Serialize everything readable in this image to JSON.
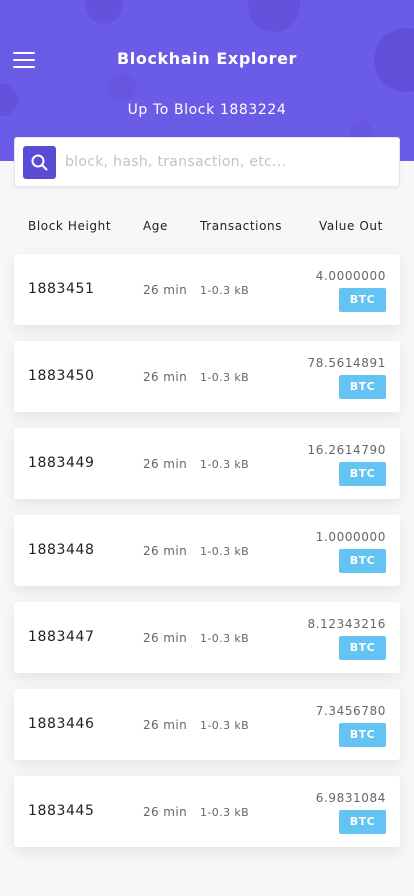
{
  "header": {
    "title": "Blockhain Explorer",
    "subtitle": "Up To Block 1883224",
    "background_color": "#6b5ce7"
  },
  "search": {
    "placeholder": "block, hash, transaction, etc...",
    "value": "",
    "icon": "search-icon"
  },
  "menu": {
    "icon": "hamburger-menu-icon"
  },
  "columns": {
    "block_height": "Block Height",
    "age": "Age",
    "transactions": "Transactions",
    "value_out": "Value Out"
  },
  "accent_colors": {
    "button": "#5b4cd6",
    "badge": "#63c3f2"
  },
  "blocks": [
    {
      "height": "1883451",
      "age": "26 min",
      "transactions": "1-0.3 kB",
      "value": "4.0000000",
      "currency": "BTC"
    },
    {
      "height": "1883450",
      "age": "26 min",
      "transactions": "1-0.3 kB",
      "value": "78.5614891",
      "currency": "BTC"
    },
    {
      "height": "1883449",
      "age": "26 min",
      "transactions": "1-0.3 kB",
      "value": "16.2614790",
      "currency": "BTC"
    },
    {
      "height": "1883448",
      "age": "26 min",
      "transactions": "1-0.3 kB",
      "value": "1.0000000",
      "currency": "BTC"
    },
    {
      "height": "1883447",
      "age": "26 min",
      "transactions": "1-0.3 kB",
      "value": "8.12343216",
      "currency": "BTC"
    },
    {
      "height": "1883446",
      "age": "26 min",
      "transactions": "1-0.3 kB",
      "value": "7.3456780",
      "currency": "BTC"
    },
    {
      "height": "1883445",
      "age": "26 min",
      "transactions": "1-0.3 kB",
      "value": "6.9831084",
      "currency": "BTC"
    }
  ]
}
